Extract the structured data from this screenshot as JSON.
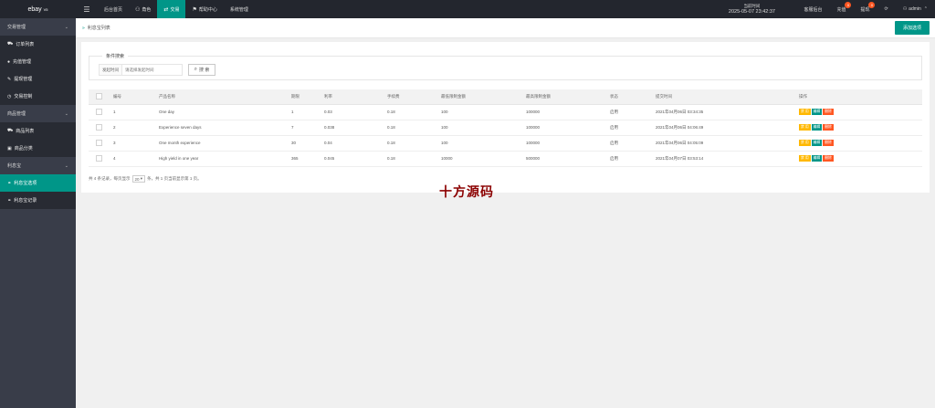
{
  "brand": {
    "name": "ebay",
    "version": "V5"
  },
  "topnav": [
    {
      "label": "后台首页",
      "icon": "",
      "active": false
    },
    {
      "label": "角色",
      "icon": "user-icon",
      "active": false
    },
    {
      "label": "交易",
      "icon": "exchange-icon",
      "active": true
    },
    {
      "label": "帮助中心",
      "icon": "flag-icon",
      "active": false
    },
    {
      "label": "系统管理",
      "icon": "",
      "active": false
    }
  ],
  "header": {
    "time_label": "当前时间",
    "time_value": "2025-05-07 23:42:37",
    "links": [
      {
        "label": "客服后台",
        "badge": ""
      },
      {
        "label": "充值",
        "badge": "0"
      },
      {
        "label": "提现",
        "badge": "0"
      }
    ],
    "refresh_icon": "refresh-icon",
    "user": "admin"
  },
  "sidebar": [
    {
      "type": "group",
      "label": "交易管理"
    },
    {
      "type": "item",
      "label": "订单列表",
      "icon": "cart-icon",
      "active": false
    },
    {
      "type": "item",
      "label": "充值管理",
      "icon": "chat-icon",
      "active": false
    },
    {
      "type": "item",
      "label": "提现管理",
      "icon": "wrench-icon",
      "active": false
    },
    {
      "type": "item",
      "label": "交易控制",
      "icon": "clock-icon",
      "active": false
    },
    {
      "type": "group",
      "label": "商品管理"
    },
    {
      "type": "item",
      "label": "商品列表",
      "icon": "cart-icon",
      "active": false
    },
    {
      "type": "item",
      "label": "商品分类",
      "icon": "bag-icon",
      "active": false
    },
    {
      "type": "group",
      "label": "利息宝"
    },
    {
      "type": "item",
      "label": "利息宝选项",
      "icon": "link-icon",
      "active": true
    },
    {
      "type": "item",
      "label": "利息宝记录",
      "icon": "link-icon",
      "active": false
    }
  ],
  "breadcrumb": {
    "text": "利息宝列表"
  },
  "add_button": "添加选项",
  "search": {
    "legend": "条件搜索",
    "label": "发起时间",
    "placeholder": "请选择发起时间",
    "button": "搜 索"
  },
  "table": {
    "headers": [
      "编号",
      "产品名称",
      "期限",
      "利率",
      "手续费",
      "最低限制金额",
      "最高限制金额",
      "状态",
      "提交时间",
      "操作"
    ],
    "rows": [
      [
        "1",
        "One day",
        "1",
        "0.03",
        "0.18",
        "100",
        "100000",
        "启用",
        "2021年04月06日 03:34:35"
      ],
      [
        "2",
        "Experience seven days",
        "7",
        "0.038",
        "0.18",
        "100",
        "100000",
        "启用",
        "2021年04月06日 04:06:49"
      ],
      [
        "3",
        "One month experience",
        "30",
        "0.04",
        "0.18",
        "100",
        "100000",
        "启用",
        "2021年04月06日 04:05:09"
      ],
      [
        "4",
        "High yield in one year",
        "365",
        "0.045",
        "0.18",
        "10000",
        "500000",
        "启用",
        "2021年04月07日 03:53:14"
      ]
    ],
    "actions": [
      "禁 用",
      "编辑",
      "删除"
    ]
  },
  "pagination": {
    "prefix": "共 4 条记录，每页显示",
    "per_page": "20",
    "suffix": "条，共 1 页当前显示第 1 页。"
  },
  "watermark": "十方源码"
}
